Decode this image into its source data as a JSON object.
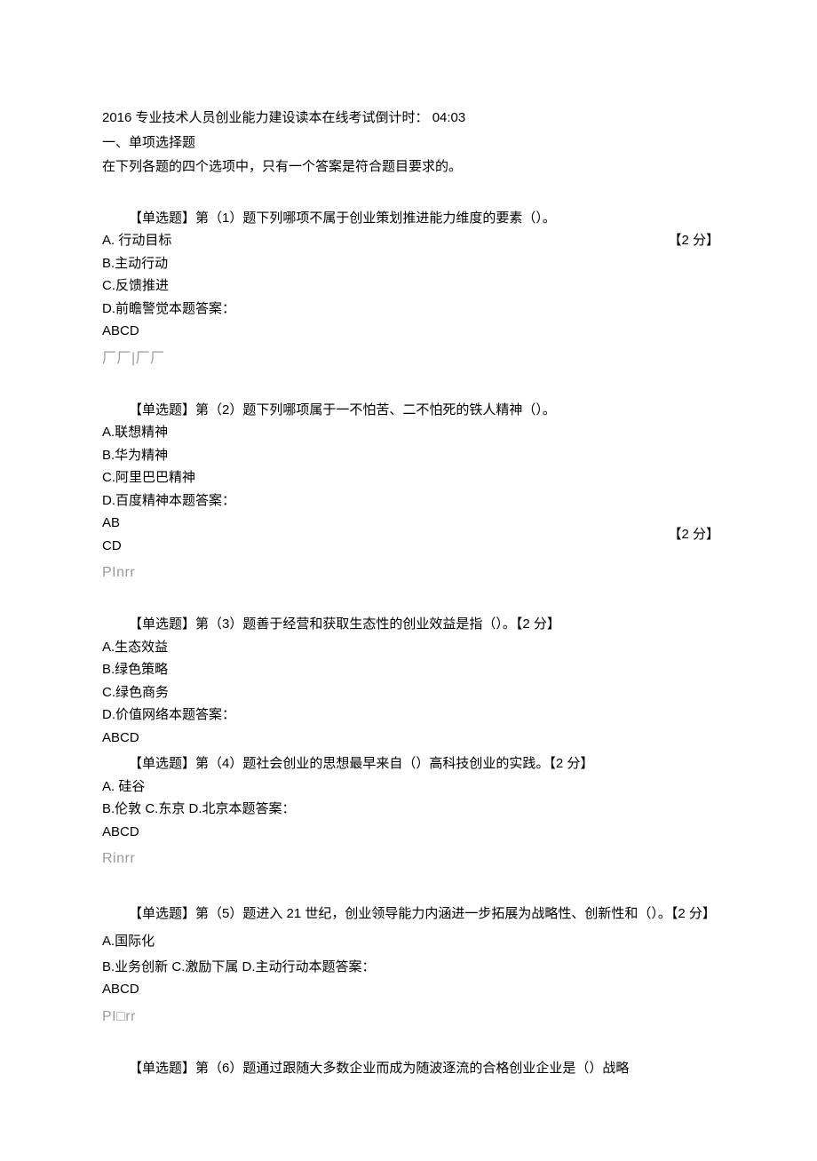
{
  "header": {
    "title_line": "2016 专业技术人员创业能力建设读本在线考试倒计时： 04:03",
    "section_title": "一、单项选择题",
    "instruction": "在下列各题的四个选项中，只有一个答案是符合题目要求的。"
  },
  "score_text": "【2 分】",
  "questions": [
    {
      "stem": "【单选题】第（1）题下列哪项不属于创业策划推进能力维度的要素（）。",
      "options_a": "A. 行动目标",
      "options": [
        "B.主动行动",
        "C.反馈推进",
        "D.前瞻警觉本题答案："
      ],
      "answer_line": "ABCD",
      "placeholder": "厂厂|厂厂",
      "score_beside": "option_a",
      "answer_two_line": false
    },
    {
      "stem": "【单选题】第（2）题下列哪项属于一不怕苦、二不怕死的铁人精神（）。",
      "options": [
        "A.联想精神",
        "B.华为精神",
        "C.阿里巴巴精神",
        "D.百度精神本题答案："
      ],
      "answer_line_1": "AB",
      "answer_line_2": "CD",
      "placeholder": "PInrr",
      "score_beside": "answer",
      "answer_two_line": true
    },
    {
      "stem": "【单选题】第（3）题善于经营和获取生态性的创业效益是指（）。【2 分】",
      "options": [
        "A.生态效益",
        "B.绿色策略",
        "C.绿色商务",
        "D.价值网络本题答案："
      ],
      "answer_line": "ABCD",
      "placeholder": "",
      "score_beside": "stem",
      "answer_two_line": false,
      "tight_bottom": true
    },
    {
      "stem": "【单选题】第（4）题社会创业的思想最早来自（）高科技创业的实践。【2 分】",
      "options_a": "A. 硅谷",
      "options": [
        "B.伦敦 C.东京 D.北京本题答案："
      ],
      "answer_line": "ABCD",
      "placeholder": "Rinrr",
      "score_beside": "stem",
      "answer_two_line": false
    },
    {
      "stem": "【单选题】第（5）题进入 21 世纪，创业领导能力内涵进一步拓展为战略性、创新性和（）。【2 分】",
      "options": [
        "A.国际化",
        "B.业务创新 C.激励下属 D.主动行动本题答案："
      ],
      "answer_line": "ABCD",
      "placeholder": "PI□rr",
      "score_beside": "stem",
      "answer_two_line": false
    },
    {
      "stem": "【单选题】第（6）题通过跟随大多数企业而成为随波逐流的合格创业企业是（）战略",
      "options": [],
      "answer_line": "",
      "placeholder": "",
      "score_beside": "none",
      "answer_two_line": false
    }
  ]
}
